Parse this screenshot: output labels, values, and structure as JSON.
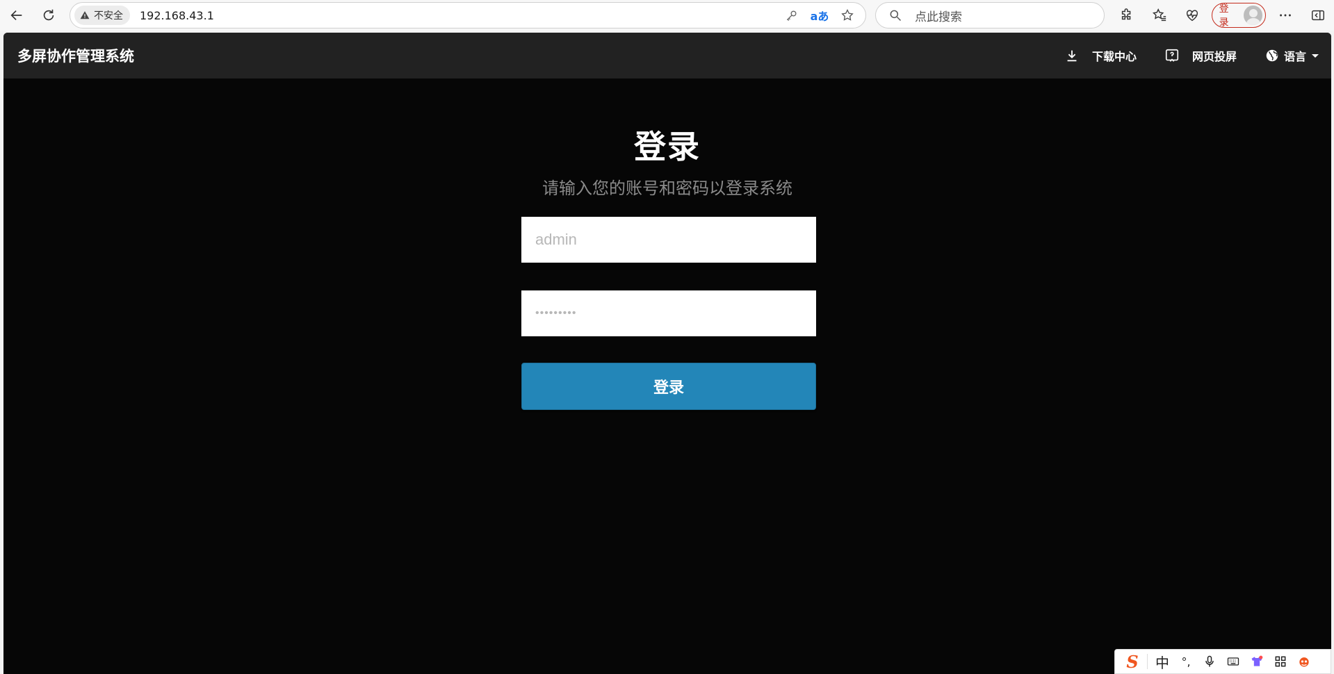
{
  "browser": {
    "security_label": "不安全",
    "url": "192.168.43.1",
    "translate_glyph": "aあ",
    "search_placeholder": "点此搜索",
    "profile_label": "登录"
  },
  "app": {
    "title": "多屏协作管理系统",
    "header_items": [
      {
        "label": "下载中心",
        "icon": "download-icon"
      },
      {
        "label": "网页投屏",
        "icon": "screen-cast-icon"
      },
      {
        "label": "语言",
        "icon": "globe-icon"
      }
    ]
  },
  "login": {
    "heading": "登录",
    "subtitle": "请输入您的账号和密码以登录系统",
    "username_placeholder": "admin",
    "password_placeholder": "•••••••••",
    "submit_label": "登录"
  },
  "ime": {
    "logo": "S",
    "mode": "中",
    "punct": "°,"
  },
  "colors": {
    "page_bg": "#060606",
    "header_bg": "#222222",
    "button_bg": "#2386b8",
    "profile_accent": "#c42b1c"
  }
}
